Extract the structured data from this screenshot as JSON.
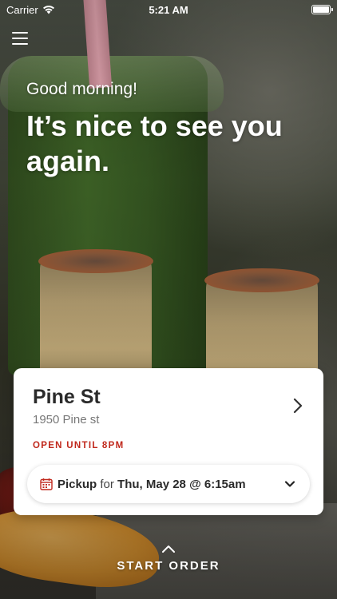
{
  "status_bar": {
    "carrier": "Carrier",
    "time": "5:21 AM",
    "battery_level": 1.0
  },
  "header": {
    "menu_icon": "hamburger-menu-icon"
  },
  "greeting": {
    "salutation": "Good morning!",
    "headline": "It’s nice to see you again."
  },
  "location_card": {
    "store_name": "Pine St",
    "store_address": "1950 Pine st",
    "hours": "OPEN UNTIL 8PM",
    "hours_color": "#c0281c",
    "pickup": {
      "mode": "Pickup",
      "connector": "for",
      "datetime": "Thu, May 28 @ 6:15am",
      "icon": "calendar-icon"
    }
  },
  "footer": {
    "start_order_label": "START ORDER",
    "icon": "chevron-up-icon"
  }
}
